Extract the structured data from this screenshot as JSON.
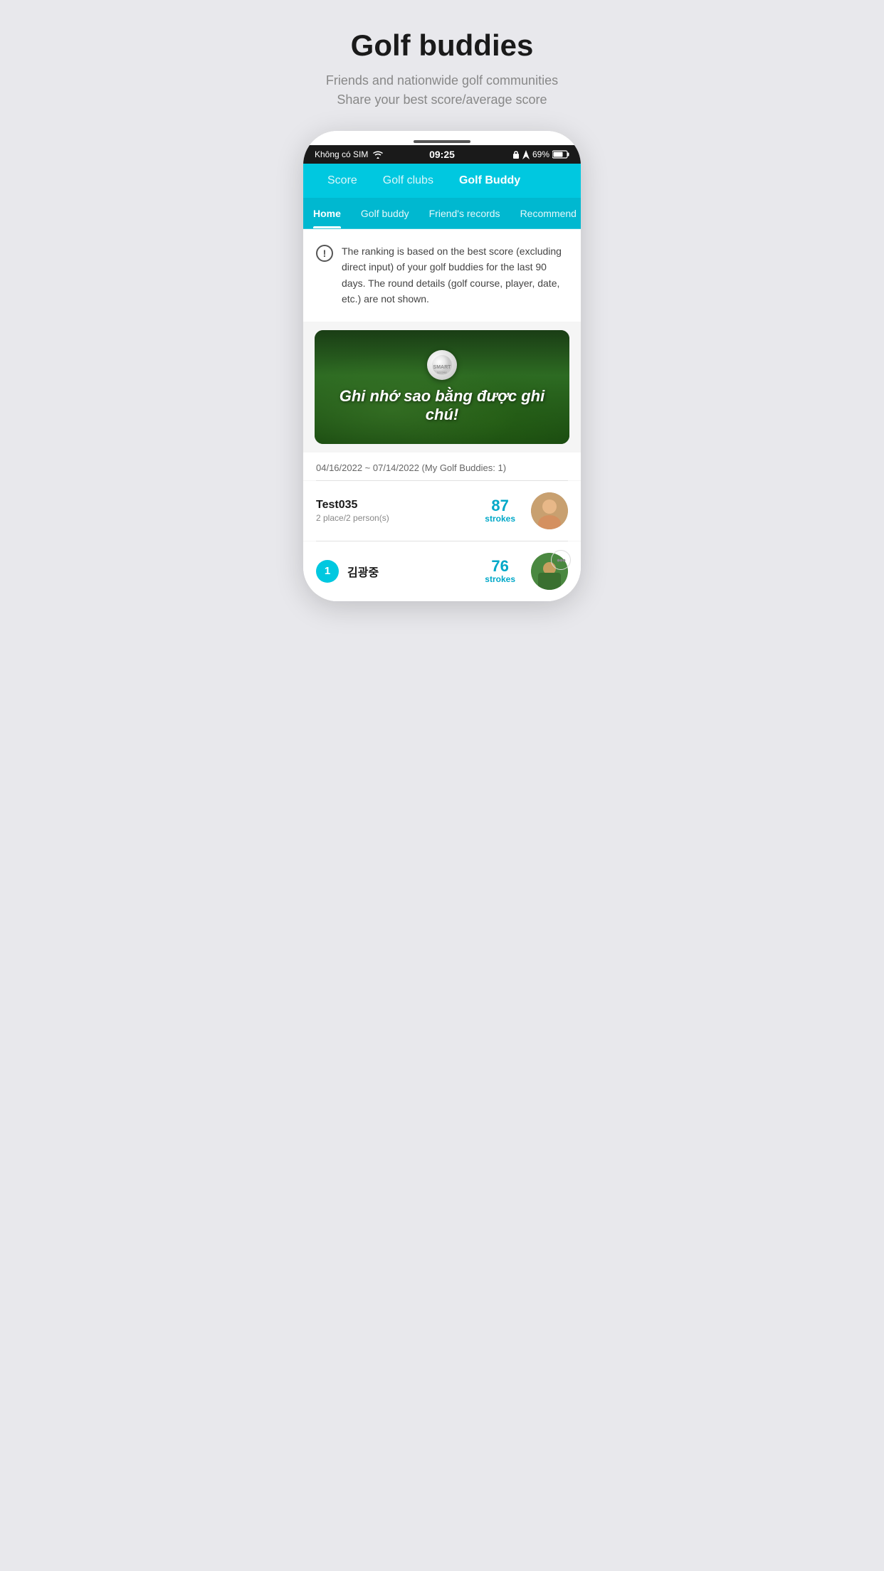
{
  "page": {
    "title": "Golf buddies",
    "subtitle_line1": "Friends and nationwide golf communities",
    "subtitle_line2": "Share your best score/average score"
  },
  "status_bar": {
    "carrier": "Không có SIM",
    "time": "09:25",
    "battery": "69%"
  },
  "top_nav": {
    "items": [
      {
        "label": "Score",
        "active": false
      },
      {
        "label": "Golf clubs",
        "active": false
      },
      {
        "label": "Golf Buddy",
        "active": true
      }
    ]
  },
  "sub_nav": {
    "items": [
      {
        "label": "Home",
        "active": true
      },
      {
        "label": "Golf buddy",
        "active": false
      },
      {
        "label": "Friend's records",
        "active": false
      },
      {
        "label": "Recommend",
        "active": false
      }
    ]
  },
  "info_notice": "The ranking is based on the best score (excluding direct input) of your golf buddies for the last 90 days. The round details (golf course, player, date, etc.) are not shown.",
  "banner_text": "Ghi nhớ sao bằng được ghi chú!",
  "date_range": "04/16/2022 ~ 07/14/2022 (My Golf Buddies: 1)",
  "users": [
    {
      "name": "Test035",
      "sub": "2 place/2 person(s)",
      "score": "87",
      "score_label": "strokes",
      "rank": null,
      "has_more": false
    },
    {
      "name": "김광중",
      "sub": "",
      "score": "76",
      "score_label": "strokes",
      "rank": "1",
      "has_more": true
    }
  ],
  "icons": {
    "wifi": "📶",
    "location": "◂",
    "lock": "🔒"
  }
}
